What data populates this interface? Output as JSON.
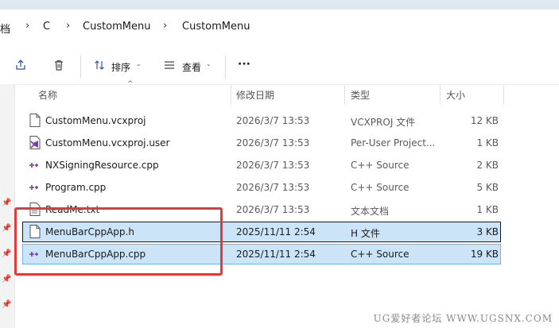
{
  "breadcrumb": [
    "档",
    "C",
    "CustomMenu",
    "CustomMenu"
  ],
  "breadcrumb_sep": "›",
  "commands": {
    "sort_label": "排序",
    "view_label": "查看",
    "more_label": "···"
  },
  "columns": {
    "name": "名称",
    "date": "修改日期",
    "type": "类型",
    "size": "大小"
  },
  "files": [
    {
      "name": "CustomMenu.vcxproj",
      "date": "2026/3/7 13:53",
      "type": "VCXPROJ 文件",
      "size": "12 KB",
      "icon": "document-icon"
    },
    {
      "name": "CustomMenu.vcxproj.user",
      "date": "2026/3/7 13:53",
      "type": "Per-User Project...",
      "size": "1 KB",
      "icon": "visual-studio-user-icon"
    },
    {
      "name": "NXSigningResource.cpp",
      "date": "2026/3/7 13:53",
      "type": "C++ Source",
      "size": "2 KB",
      "icon": "cpp-icon"
    },
    {
      "name": "Program.cpp",
      "date": "2026/3/7 13:53",
      "type": "C++ Source",
      "size": "5 KB",
      "icon": "cpp-icon"
    },
    {
      "name": "ReadMe.txt",
      "date": "2026/3/7 13:53",
      "type": "文本文档",
      "size": "1 KB",
      "icon": "text-document-icon"
    },
    {
      "name": "MenuBarCppApp.h",
      "date": "2025/11/11 2:54",
      "type": "H 文件",
      "size": "3 KB",
      "icon": "document-icon",
      "selected": true
    },
    {
      "name": "MenuBarCppApp.cpp",
      "date": "2025/11/11 2:54",
      "type": "C++ Source",
      "size": "19 KB",
      "icon": "cpp-icon",
      "selected": true
    }
  ],
  "watermark": "UG爱好者论坛 WWW.UGSNX.COM",
  "colors": {
    "selection": "#cce4f7",
    "highlight": "#e03a3a",
    "accent": "#2d5b9a"
  }
}
